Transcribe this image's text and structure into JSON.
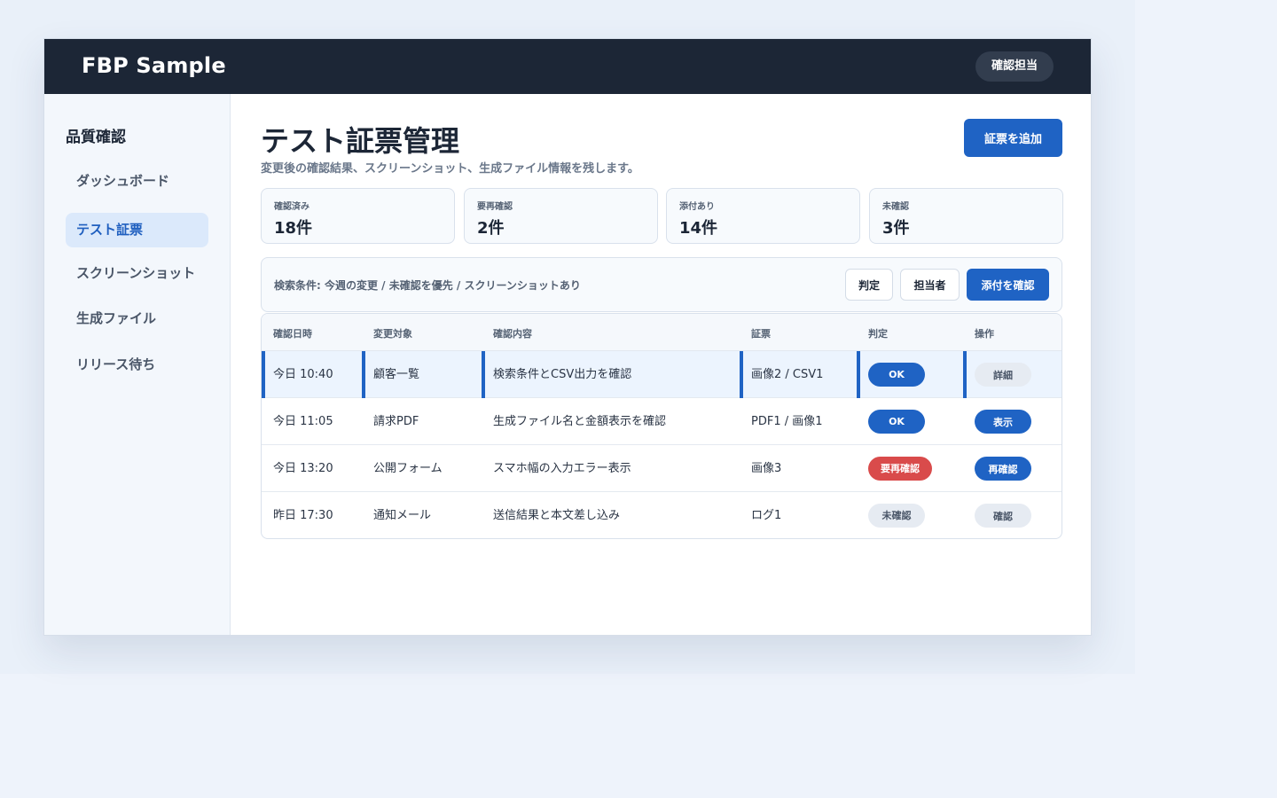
{
  "app": {
    "brand": "FBP Sample",
    "role": "確認担当"
  },
  "sidebar": {
    "title": "品質確認",
    "items": [
      {
        "label": "ダッシュボード"
      },
      {
        "label": "テスト証票"
      },
      {
        "label": "スクリーンショット"
      },
      {
        "label": "生成ファイル"
      },
      {
        "label": "リリース待ち"
      }
    ]
  },
  "page": {
    "title": "テスト証票管理",
    "subtitle": "変更後の確認結果、スクリーンショット、生成ファイル情報を残します。",
    "add_button": "証票を追加"
  },
  "stats": [
    {
      "label": "確認済み",
      "value": "18件"
    },
    {
      "label": "要再確認",
      "value": "2件"
    },
    {
      "label": "添付あり",
      "value": "14件"
    },
    {
      "label": "未確認",
      "value": "3件"
    }
  ],
  "filter": {
    "text": "検索条件: 今週の変更 / 未確認を優先 / スクリーンショットあり",
    "btn_judge": "判定",
    "btn_owner": "担当者",
    "btn_attach": "添付を確認"
  },
  "table": {
    "headers": [
      "確認日時",
      "変更対象",
      "確認内容",
      "証票",
      "判定",
      "操作"
    ],
    "rows": [
      {
        "datetime": "今日 10:40",
        "target": "顧客一覧",
        "content": "検索条件とCSV出力を確認",
        "evidence": "画像2 / CSV1",
        "status": "OK",
        "action": "詳細"
      },
      {
        "datetime": "今日 11:05",
        "target": "請求PDF",
        "content": "生成ファイル名と金額表示を確認",
        "evidence": "PDF1 / 画像1",
        "status": "OK",
        "action": "表示"
      },
      {
        "datetime": "今日 13:20",
        "target": "公開フォーム",
        "content": "スマホ幅の入力エラー表示",
        "evidence": "画像3",
        "status": "要再確認",
        "action": "再確認"
      },
      {
        "datetime": "昨日 17:30",
        "target": "通知メール",
        "content": "送信結果と本文差し込み",
        "evidence": "ログ1",
        "status": "未確認",
        "action": "確認"
      }
    ]
  },
  "colors": {
    "topbar": "#1c2636",
    "accent": "#1f63c4",
    "danger": "#d94b4b",
    "neutral": "#e6ebf2"
  }
}
